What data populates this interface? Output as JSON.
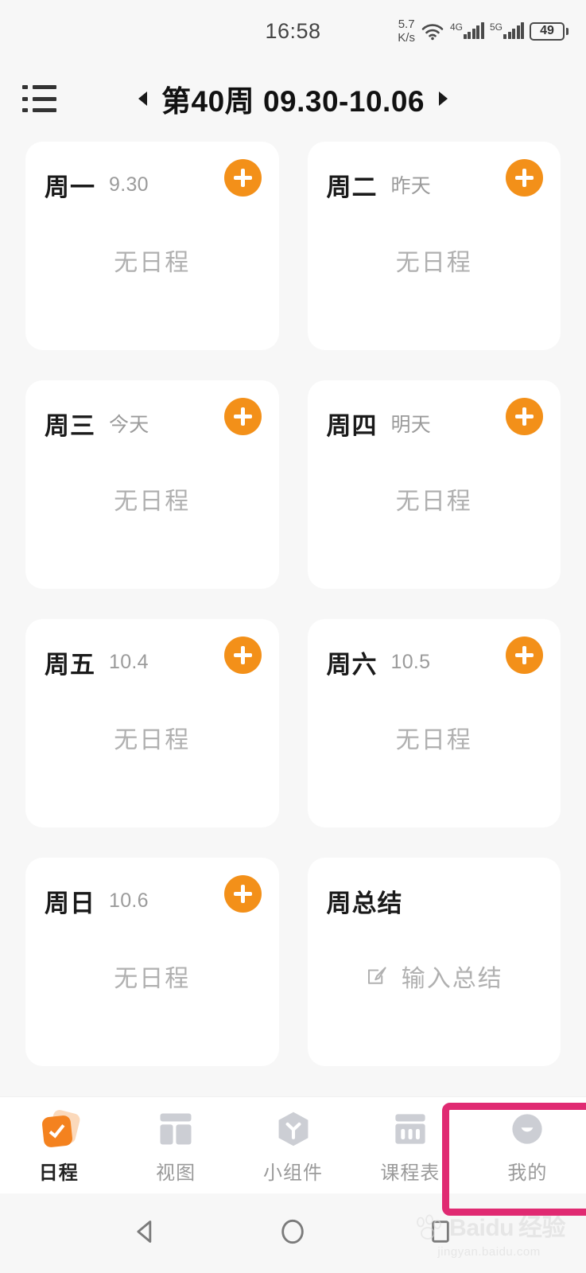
{
  "status_bar": {
    "clock": "16:58",
    "net_speed_value": "5.7",
    "net_speed_unit": "K/s",
    "wifi_icon": "wifi-icon",
    "sim1_label": "4G",
    "sim2_label": "5G",
    "battery_percent": "49"
  },
  "header": {
    "list_icon": "list-view-icon",
    "prev_icon": "chevron-left-icon",
    "next_icon": "chevron-right-icon",
    "week_title": "第40周  09.30-10.06"
  },
  "cards": [
    {
      "day": "周一",
      "date": "9.30",
      "empty": "无日程",
      "add": "add-icon"
    },
    {
      "day": "周二",
      "date": "昨天",
      "empty": "无日程",
      "add": "add-icon"
    },
    {
      "day": "周三",
      "date": "今天",
      "empty": "无日程",
      "add": "add-icon"
    },
    {
      "day": "周四",
      "date": "明天",
      "empty": "无日程",
      "add": "add-icon"
    },
    {
      "day": "周五",
      "date": "10.4",
      "empty": "无日程",
      "add": "add-icon"
    },
    {
      "day": "周六",
      "date": "10.5",
      "empty": "无日程",
      "add": "add-icon"
    },
    {
      "day": "周日",
      "date": "10.6",
      "empty": "无日程",
      "add": "add-icon"
    }
  ],
  "summary_card": {
    "title": "周总结",
    "action_label": "输入总结",
    "action_icon": "edit-square-icon"
  },
  "tabs": [
    {
      "label": "日程",
      "icon": "schedule-check-icon",
      "active": true
    },
    {
      "label": "视图",
      "icon": "layout-grid-icon",
      "active": false
    },
    {
      "label": "小组件",
      "icon": "widget-hexagon-icon",
      "active": false
    },
    {
      "label": "课程表",
      "icon": "timetable-icon",
      "active": false
    },
    {
      "label": "我的",
      "icon": "avatar-smile-icon",
      "active": false
    }
  ],
  "system_nav": {
    "back_icon": "triangle-back-icon",
    "home_icon": "circle-home-icon",
    "recents_icon": "square-recents-icon"
  },
  "watermark": {
    "brand": "Baidu",
    "brand_cn": "经验",
    "url": "jingyan.baidu.com",
    "paw_icon": "baidu-paw-icon"
  },
  "colors": {
    "accent_orange": "#f39019",
    "highlight_pink": "#e02a72",
    "card_white": "#ffffff",
    "page_bg": "#f7f7f7",
    "muted_text": "#b0b0b0"
  }
}
